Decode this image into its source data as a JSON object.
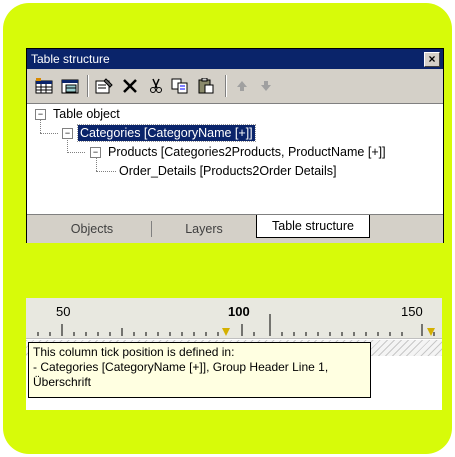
{
  "window": {
    "title": "Table structure",
    "close_label": "×"
  },
  "toolbar": {
    "buttons": [
      {
        "name": "insert-table-icon"
      },
      {
        "name": "insert-subtable-icon"
      },
      {
        "name": "properties-icon"
      },
      {
        "name": "delete-icon"
      },
      {
        "name": "cut-icon"
      },
      {
        "name": "copy-icon"
      },
      {
        "name": "paste-icon"
      },
      {
        "name": "move-up-icon"
      },
      {
        "name": "move-down-icon"
      }
    ]
  },
  "tree": {
    "root": {
      "label": "Table object",
      "expander": "−"
    },
    "categories": {
      "label": "Categories [CategoryName [+]]",
      "expander": "−"
    },
    "products": {
      "label": "Products [Categories2Products, ProductName [+]]",
      "expander": "−"
    },
    "order_details": {
      "label": "Order_Details [Products2Order Details]"
    }
  },
  "tabs": [
    {
      "label": "Objects"
    },
    {
      "label": "Layers"
    },
    {
      "label": "Table structure",
      "active": true
    }
  ],
  "ruler": {
    "labels": [
      "50",
      "100",
      "150"
    ],
    "tooltip": {
      "line1": "This column tick position is defined in:",
      "line2": "- Categories [CategoryName [+]], Group Header Line 1,",
      "line3": "Überschrift"
    }
  },
  "colors": {
    "frame": "#d7fb09",
    "titlebar": "#0a246a",
    "selection": "#0a246a",
    "tooltip_bg": "#ffffe1"
  }
}
